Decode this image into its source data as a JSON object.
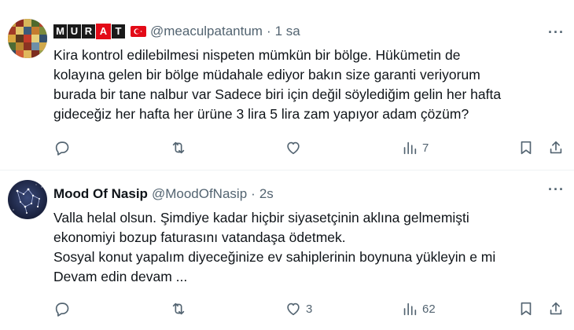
{
  "tweets": [
    {
      "name_badge_letters": [
        "M",
        "U",
        "R",
        "A",
        "T"
      ],
      "handle": "@meaculpatantum",
      "separator": "·",
      "time": "1 sa",
      "more": "···",
      "lines": [
        "Kira kontrol edilebilmesi nispeten mümkün bir bölge. Hükümetin de",
        "kolayına gelen bir bölge müdahale ediyor bakın size garanti veriyorum",
        "burada bir tane nalbur var Sadece biri için değil söylediğim gelin her hafta",
        "gideceğiz her hafta her ürüne 3 lira 5 lira zam yapıyor adam çözüm?"
      ],
      "counts": {
        "reply": "",
        "retweet": "",
        "like": "",
        "views": "7"
      },
      "icons": [
        "reply-icon",
        "retweet-icon",
        "like-icon",
        "views-icon",
        "bookmark-icon",
        "share-icon"
      ]
    },
    {
      "name": "Mood Of Nasip",
      "handle": "@MoodOfNasip",
      "separator": "·",
      "time": "2s",
      "more": "···",
      "lines": [
        "Valla helal olsun. Şimdiye kadar hiçbir siyasetçinin aklına gelmemişti",
        "ekonomiyi bozup faturasını vatandaşa ödetmek.",
        "Sosyal konut yapalım diyeceğinize ev sahiplerinin boynuna yükleyin e mi",
        "Devam edin devam ..."
      ],
      "counts": {
        "reply": "",
        "retweet": "",
        "like": "3",
        "views": "62"
      },
      "icons": [
        "reply-icon",
        "retweet-icon",
        "like-icon",
        "views-icon",
        "bookmark-icon",
        "share-icon"
      ]
    }
  ],
  "colors": {
    "text": "#0f1419",
    "secondary": "#536471",
    "divider": "#eff3f4",
    "flag_red": "#e30a17"
  }
}
